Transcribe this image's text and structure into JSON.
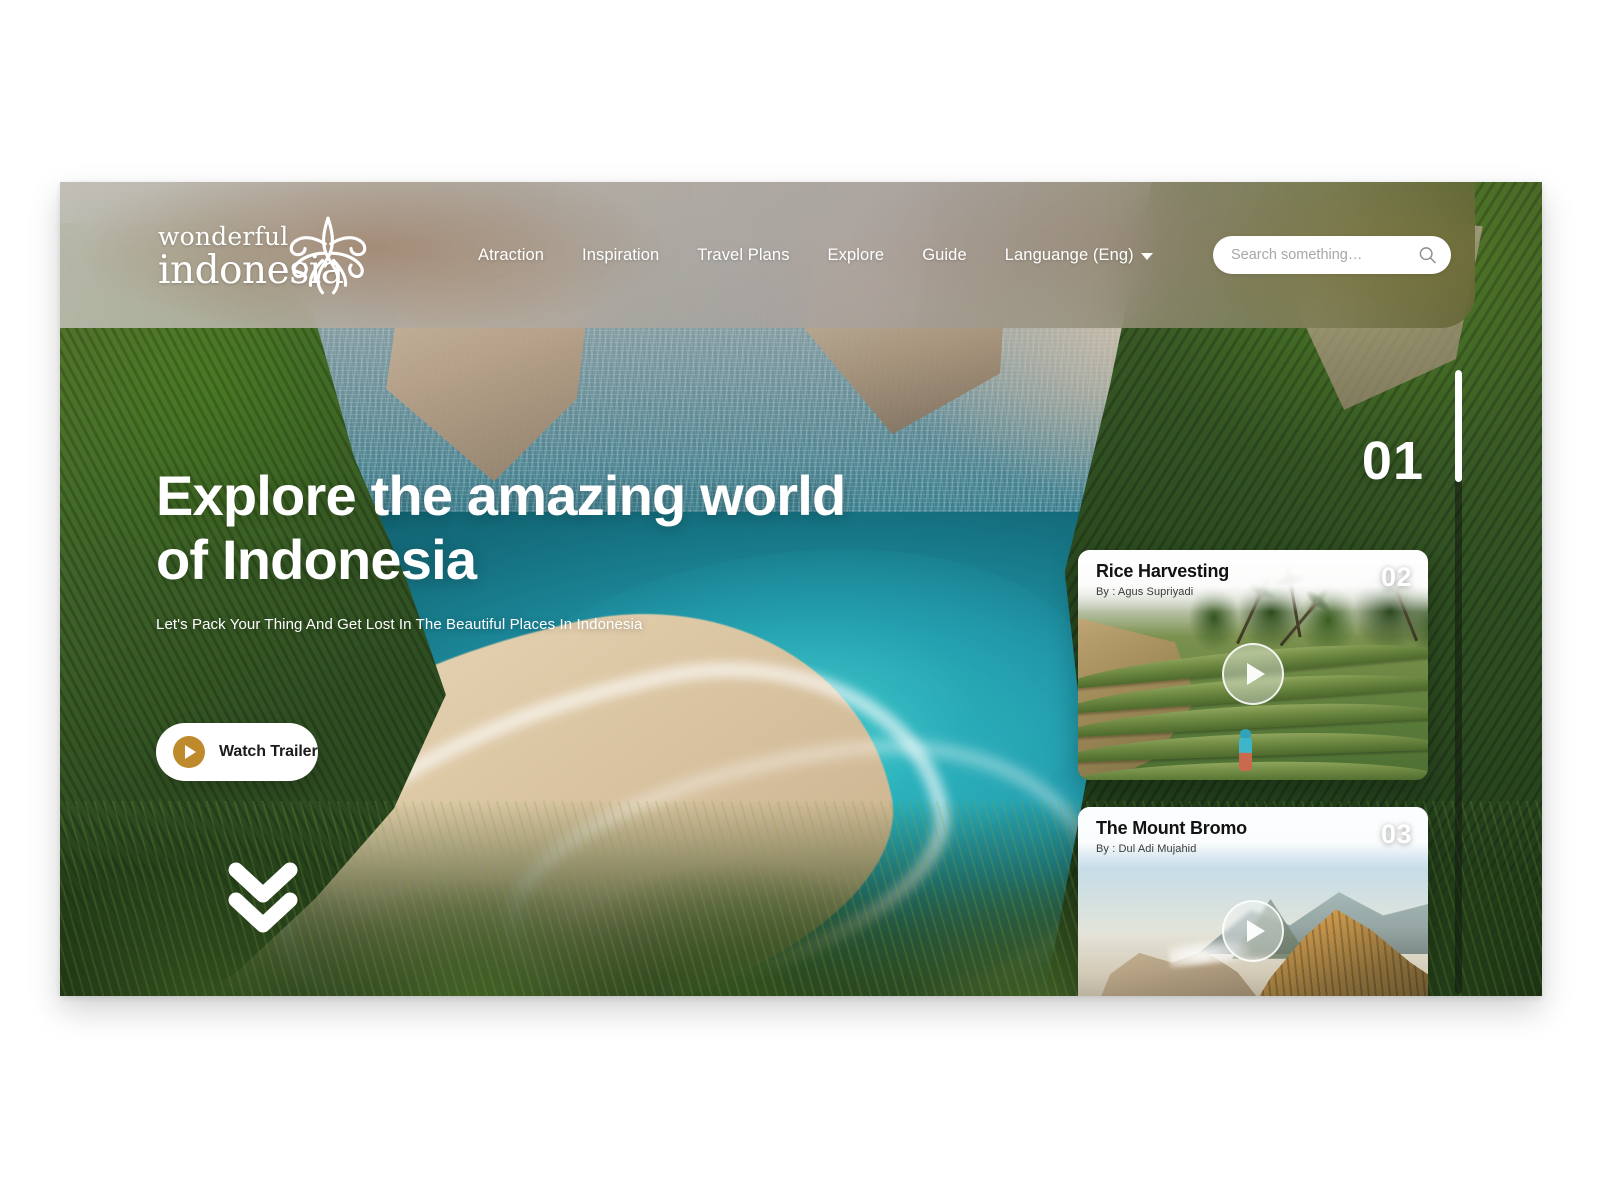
{
  "brand": {
    "line1": "wonderful",
    "line2": "indonesia",
    "mark": "garuda-flourish-icon"
  },
  "nav": {
    "items": [
      {
        "label": "Atraction"
      },
      {
        "label": "Inspiration"
      },
      {
        "label": "Travel Plans"
      },
      {
        "label": "Explore"
      },
      {
        "label": "Guide"
      }
    ],
    "language": {
      "label": "Languange (Eng)",
      "caret": "chevron-down-icon"
    }
  },
  "search": {
    "placeholder": "Search something…",
    "value": "",
    "icon": "search-icon"
  },
  "hero": {
    "headline_line1": "Explore the amazing world",
    "headline_line2": "of Indonesia",
    "subhead": "Let's Pack Your Thing And Get Lost In The Beautiful Places In Indonesia",
    "cta": {
      "label": "Watch Trailer",
      "icon": "play-icon",
      "accent": "#be8a2b"
    },
    "scroll_hint_icon": "double-chevron-down-icon",
    "slide_number": "01"
  },
  "progress": {
    "fill_percent": 18
  },
  "cards": [
    {
      "index": "02",
      "title": "Rice Harvesting",
      "author": "By : Agus Supriyadi",
      "play_icon": "play-icon"
    },
    {
      "index": "03",
      "title": "The Mount Bromo",
      "author": "By : Dul Adi Mujahid",
      "play_icon": "play-icon"
    }
  ]
}
